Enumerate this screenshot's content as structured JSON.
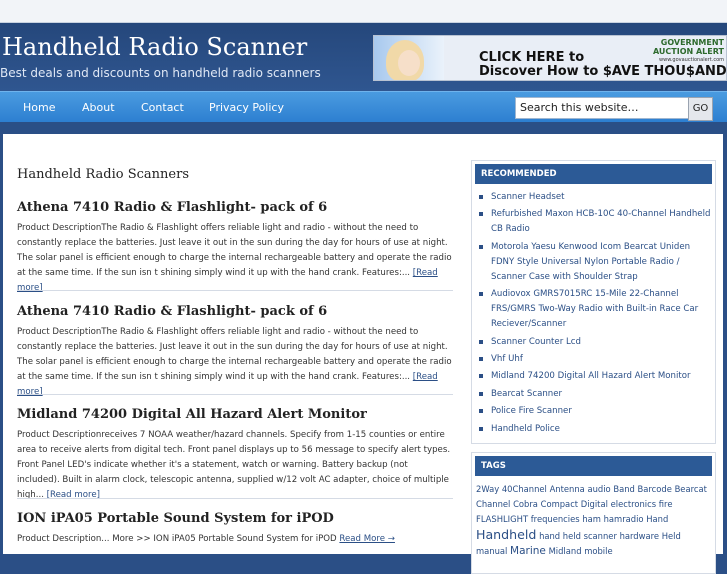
{
  "site": {
    "title": "Handheld Radio Scanner",
    "tagline": "Best deals and discounts on handheld radio scanners"
  },
  "ad": {
    "logo_line1": "GOVERNMENT",
    "logo_line2": "AUCTION ALERT",
    "logo_url": "www.govauctionalert.com",
    "headline1": "CLICK HERE to",
    "headline2": "Discover How to $AVE THOU$AND$!"
  },
  "nav": {
    "items": [
      "Home",
      "About",
      "Contact",
      "Privacy Policy"
    ],
    "search_placeholder": "Search this website…",
    "search_button": "GO"
  },
  "main": {
    "section_title": "Handheld Radio Scanners",
    "read_more": "[Read more]",
    "posts": [
      {
        "title": "Athena 7410 Radio & Flashlight- pack of 6",
        "text": "Product DescriptionThe Radio & Flashlight offers reliable light and radio - without the need to constantly replace the batteries. Just leave it out in the sun during the day for hours of use at night. The solar panel is efficient enough to charge the internal rechargeable battery and operate the radio at the same time. If the sun isn t shining simply wind it up with the hand crank. Features:..."
      },
      {
        "title": "Athena 7410 Radio & Flashlight- pack of 6",
        "text": "Product DescriptionThe Radio & Flashlight offers reliable light and radio - without the need to constantly replace the batteries. Just leave it out in the sun during the day for hours of use at night. The solar panel is efficient enough to charge the internal rechargeable battery and operate the radio at the same time. If the sun isn t shining simply wind it up with the hand crank. Features:..."
      },
      {
        "title": "Midland 74200 Digital All Hazard Alert Monitor",
        "text": "Product Descriptionreceives 7 NOAA weather/hazard channels. Specify from 1-15 counties or entire area to receive alerts from digital tech. Front panel displays up to 56 message to specify alert types. Front Panel LED's indicate whether it's a statement, watch or warning. Battery backup (not included). Built in alarm clock, telescopic antenna, supplied w/12 volt AC adapter, choice of multiple high..."
      },
      {
        "title": "ION iPA05 Portable Sound System for iPOD",
        "text": "Product Description... More >> ION iPA05 Portable Sound System for iPOD",
        "more_label": "Read More →"
      }
    ]
  },
  "sidebar": {
    "recommended_title": "RECOMMENDED",
    "recommended": [
      "Scanner Headset",
      "Refurbished Maxon HCB-10C 40-Channel Handheld CB Radio",
      "Motorola Yaesu Kenwood Icom Bearcat Uniden FDNY Style Universal Nylon Portable Radio / Scanner Case with Shoulder Strap",
      "Audiovox GMRS7015RC 15-Mile 22-Channel FRS/GMRS Two-Way Radio with Built-in Race Car Reciever/Scanner",
      "Scanner Counter Lcd",
      "Vhf Uhf",
      "Midland 74200 Digital All Hazard Alert Monitor",
      "Bearcat Scanner",
      "Police Fire Scanner",
      "Handheld Police"
    ],
    "tags_title": "TAGS",
    "tags": [
      {
        "t": "2Way",
        "s": 8
      },
      {
        "t": "40Channel",
        "s": 8
      },
      {
        "t": "Antenna",
        "s": 8
      },
      {
        "t": "audio",
        "s": 8
      },
      {
        "t": "Band",
        "s": 8
      },
      {
        "t": "Barcode",
        "s": 8
      },
      {
        "t": "Bearcat",
        "s": 8
      },
      {
        "t": "Channel",
        "s": 8
      },
      {
        "t": "Cobra",
        "s": 8
      },
      {
        "t": "Compact",
        "s": 8
      },
      {
        "t": "Digital",
        "s": 8
      },
      {
        "t": "electronics",
        "s": 8
      },
      {
        "t": "fire",
        "s": 8
      },
      {
        "t": "FLASHLIGHT",
        "s": 8
      },
      {
        "t": "frequencies",
        "s": 8
      },
      {
        "t": "ham",
        "s": 8
      },
      {
        "t": "hamradio",
        "s": 8
      },
      {
        "t": "Hand",
        "s": 8
      },
      {
        "t": "Handheld",
        "s": 12
      },
      {
        "t": "hand held",
        "s": 8
      },
      {
        "t": "scanner",
        "s": 8
      },
      {
        "t": "hardware",
        "s": 8
      },
      {
        "t": "Held",
        "s": 8
      },
      {
        "t": "manual",
        "s": 8
      },
      {
        "t": "Marine",
        "s": 10
      },
      {
        "t": "Midland",
        "s": 8
      },
      {
        "t": "mobile",
        "s": 8
      }
    ]
  }
}
